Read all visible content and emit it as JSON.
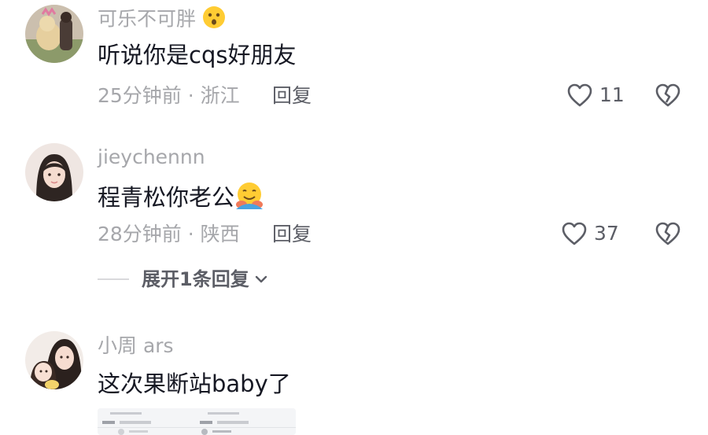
{
  "comments": [
    {
      "username": "可乐不可胖",
      "text": "听说你是cqs好朋友",
      "time": "25分钟前",
      "separator": "·",
      "location": "浙江",
      "reply_label": "回复",
      "likes": "11",
      "avatar_icon": "avatar-photo-dog",
      "username_emoji": "hushed-face-emoji"
    },
    {
      "username": "jieychennn",
      "text": "程青松你老公",
      "time": "28分钟前",
      "separator": "·",
      "location": "陕西",
      "reply_label": "回复",
      "likes": "37",
      "avatar_icon": "avatar-photo-girl",
      "text_emoji": "hugging-face-emoji"
    },
    {
      "username": "小周 ars",
      "text": "这次果断站baby了",
      "avatar_icon": "avatar-photo-two-girls"
    }
  ],
  "expand_replies_label": "展开1条回复",
  "colors": {
    "secondary_text": "#a6a7ab",
    "action_text": "#5c5e66",
    "primary_text": "#161823"
  }
}
